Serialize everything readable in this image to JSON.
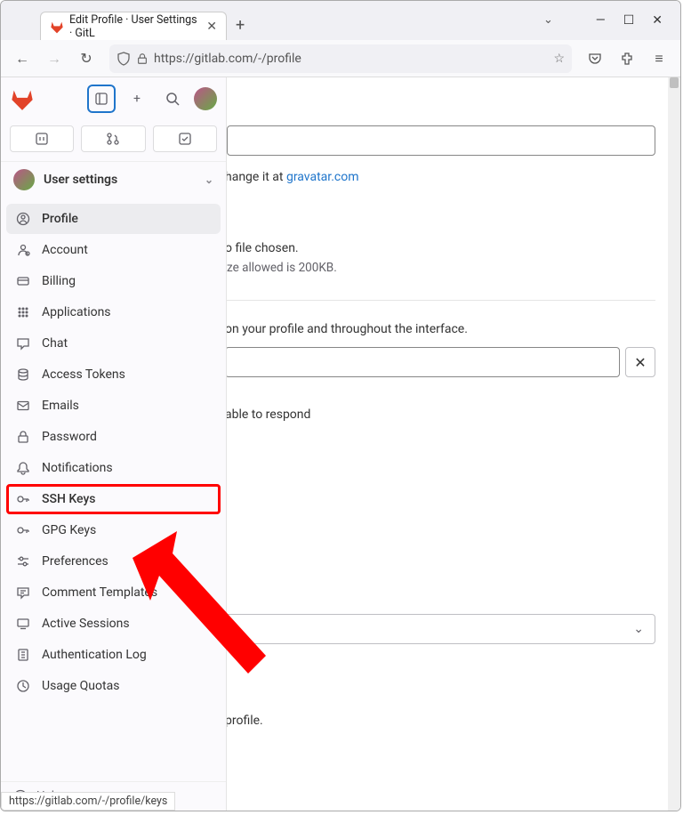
{
  "browser": {
    "tab_title": "Edit Profile · User Settings · GitL",
    "url": "https://gitlab.com/-/profile",
    "status_link": "https://gitlab.com/-/profile/keys"
  },
  "sidebar": {
    "title": "User settings",
    "items": [
      {
        "label": "Profile",
        "icon": "profile-icon",
        "active": true
      },
      {
        "label": "Account",
        "icon": "account-icon"
      },
      {
        "label": "Billing",
        "icon": "billing-icon"
      },
      {
        "label": "Applications",
        "icon": "applications-icon"
      },
      {
        "label": "Chat",
        "icon": "chat-icon"
      },
      {
        "label": "Access Tokens",
        "icon": "token-icon"
      },
      {
        "label": "Emails",
        "icon": "emails-icon"
      },
      {
        "label": "Password",
        "icon": "password-icon"
      },
      {
        "label": "Notifications",
        "icon": "notifications-icon"
      },
      {
        "label": "SSH Keys",
        "icon": "ssh-key-icon",
        "highlight": true
      },
      {
        "label": "GPG Keys",
        "icon": "gpg-key-icon"
      },
      {
        "label": "Preferences",
        "icon": "preferences-icon"
      },
      {
        "label": "Comment Templates",
        "icon": "comment-templates-icon"
      },
      {
        "label": "Active Sessions",
        "icon": "active-sessions-icon"
      },
      {
        "label": "Authentication Log",
        "icon": "auth-log-icon"
      },
      {
        "label": "Usage Quotas",
        "icon": "usage-quotas-icon"
      }
    ],
    "help_label": "Help"
  },
  "content": {
    "avatar_text_prefix": "hange it at ",
    "avatar_link": "gravatar.com",
    "upload_text": "o file chosen.",
    "upload_hint": "ze allowed is 200KB.",
    "full_name_hint": "on your profile and throughout the interface.",
    "id_hint": "able to respond",
    "profile_text": "profile."
  }
}
